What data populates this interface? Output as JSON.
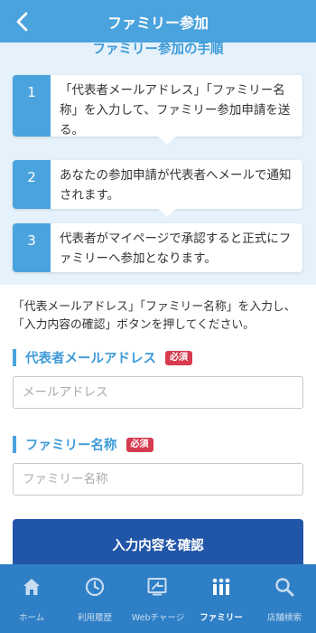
{
  "header": {
    "title": "ファミリー参加",
    "back_icon": "chevron-left-icon"
  },
  "steps": {
    "title": "ファミリー参加の手順",
    "items": [
      {
        "number": "1",
        "text": "「代表者メールアドレス」「ファミリー名称」を入力して、ファミリー参加申請を送る。"
      },
      {
        "number": "2",
        "text": "あなたの参加申請が代表者へメールで通知されます。"
      },
      {
        "number": "3",
        "text": "代表者がマイページで承認すると正式にファミリーへ参加となります。"
      }
    ]
  },
  "form": {
    "instructions": "「代表メールアドレス」「ファミリー名称」を入力し、「入力内容の確認」ボタンを押してください。",
    "email": {
      "label": "代表者メールアドレス",
      "required": "必須",
      "placeholder": "メールアドレス",
      "value": ""
    },
    "family_name": {
      "label": "ファミリー名称",
      "required": "必須",
      "placeholder": "ファミリー名称",
      "value": ""
    },
    "confirm_label": "入力内容を確認"
  },
  "nav": {
    "items": [
      {
        "label": "ホーム",
        "icon": "home-icon"
      },
      {
        "label": "利用履歴",
        "icon": "clock-icon"
      },
      {
        "label": "Webチャージ",
        "icon": "charge-icon"
      },
      {
        "label": "ファミリー",
        "icon": "family-icon",
        "active": true
      },
      {
        "label": "店舗検索",
        "icon": "search-icon"
      }
    ]
  },
  "colors": {
    "header": "#4aa3dd",
    "panel": "#e5f1fb",
    "button": "#2155a8",
    "nav": "#2f7fc6",
    "required": "#d63b4f"
  }
}
